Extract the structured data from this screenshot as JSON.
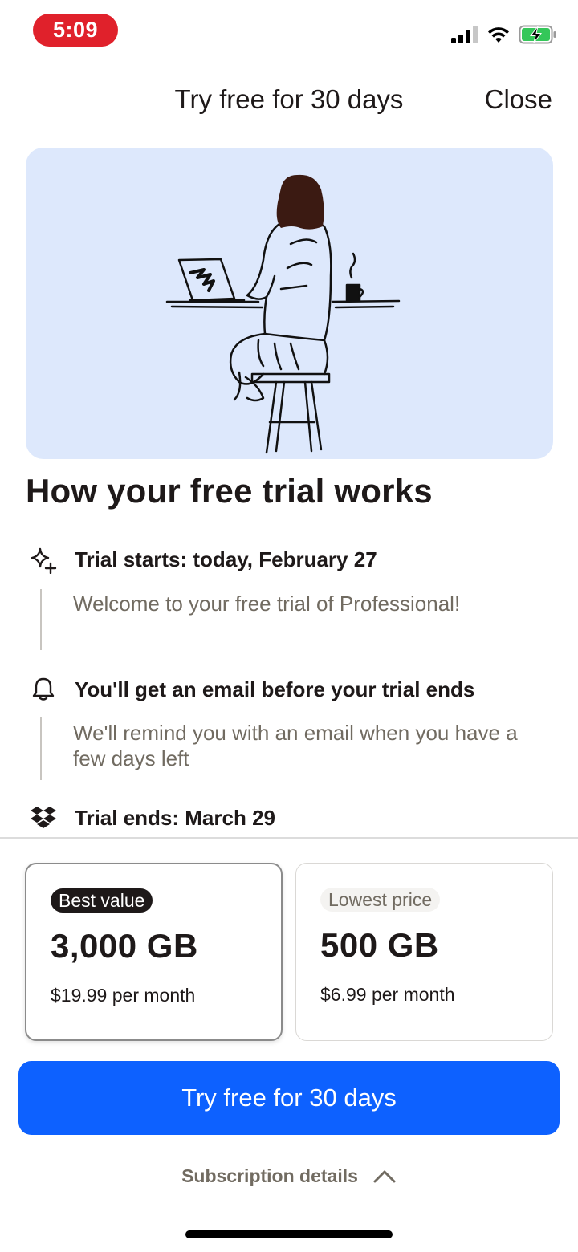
{
  "status_bar": {
    "time": "5:09",
    "icons": [
      "cellular-signal-icon",
      "wifi-icon",
      "battery-charging-icon"
    ],
    "time_pill_color": "#e0212b"
  },
  "header": {
    "title": "Try free for 30 days",
    "close_label": "Close"
  },
  "hero": {
    "illustration": "person-at-laptop-illustration",
    "background": "#dde8fc"
  },
  "section_title": "How your free trial works",
  "timeline": [
    {
      "icon": "sparkle-icon",
      "title": "Trial starts: today, February 27",
      "description": "Welcome to your free trial of Professional!"
    },
    {
      "icon": "bell-icon",
      "title": "You'll get an email before your trial ends",
      "description": "We'll remind you with an email when you have a few days left"
    },
    {
      "icon": "dropbox-icon",
      "title": "Trial ends: March 29",
      "description": ""
    }
  ],
  "plans": [
    {
      "badge": "Best value",
      "size": "3,000 GB",
      "price": "$19.99 per month",
      "selected": true
    },
    {
      "badge": "Lowest price",
      "size": "500 GB",
      "price": "$6.99 per month",
      "selected": false
    }
  ],
  "cta": {
    "label": "Try free for 30 days",
    "color": "#0d61ff"
  },
  "subscription_details": {
    "label": "Subscription details",
    "icon": "chevron-up-icon"
  }
}
